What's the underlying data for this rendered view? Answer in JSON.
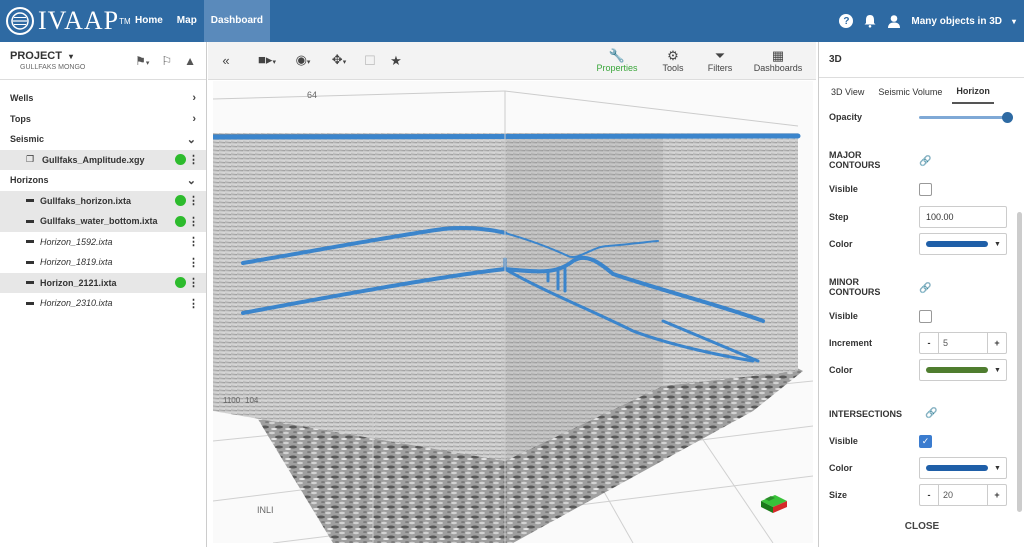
{
  "app": {
    "logo_text": "IVAAP",
    "logo_tm": "TM"
  },
  "nav": {
    "items": [
      {
        "label": "Home"
      },
      {
        "label": "Map"
      },
      {
        "label": "Dashboard"
      }
    ]
  },
  "topbar": {
    "help_glyph": "?",
    "user_label": "Many objects in 3D"
  },
  "project": {
    "title": "PROJECT",
    "subtitle": "GULLFAKS MONGO"
  },
  "tree": {
    "wells": "Wells",
    "tops": "Tops",
    "seismic": "Seismic",
    "seismic_items": [
      {
        "label": "Gullfaks_Amplitude.xgy"
      }
    ],
    "horizons": "Horizons",
    "horizon_items": [
      {
        "label": "Gullfaks_horizon.ixta"
      },
      {
        "label": "Gullfaks_water_bottom.ixta"
      },
      {
        "label": "Horizon_1592.ixta"
      },
      {
        "label": "Horizon_1819.ixta"
      },
      {
        "label": "Horizon_2121.ixta"
      },
      {
        "label": "Horizon_2310.ixta"
      }
    ]
  },
  "toolbar": {
    "properties": "Properties",
    "tools": "Tools",
    "filters": "Filters",
    "dashboards": "Dashboards"
  },
  "viewport": {
    "label_64": "64",
    "label_1100": "1100",
    "label_104": "104",
    "label_inli": "INLI"
  },
  "panel": {
    "title": "3D",
    "tabs": [
      {
        "label": "3D View"
      },
      {
        "label": "Seismic Volume"
      },
      {
        "label": "Horizon"
      }
    ],
    "opacity_label": "Opacity",
    "opacity_value": 1.0,
    "major_title_1": "MAJOR",
    "major_title_2": "CONTOURS",
    "major_visible_label": "Visible",
    "major_step_label": "Step",
    "major_step_value": "100.00",
    "major_color_label": "Color",
    "minor_title_1": "MINOR",
    "minor_title_2": "CONTOURS",
    "minor_visible_label": "Visible",
    "minor_increment_label": "Increment",
    "minor_increment_value": "5",
    "minor_color_label": "Color",
    "intersections_title": "INTERSECTIONS",
    "int_visible_label": "Visible",
    "int_color_label": "Color",
    "int_size_label": "Size",
    "int_size_value": "20",
    "close_label": "CLOSE",
    "minus_glyph": "-",
    "plus_glyph": "+"
  },
  "colors": {
    "brand": "#2e6aa3",
    "major_color": "#1f5fa8",
    "minor_color": "#4f7d2f",
    "int_color": "#1f5fa8",
    "status_green": "#2dbb2d"
  }
}
